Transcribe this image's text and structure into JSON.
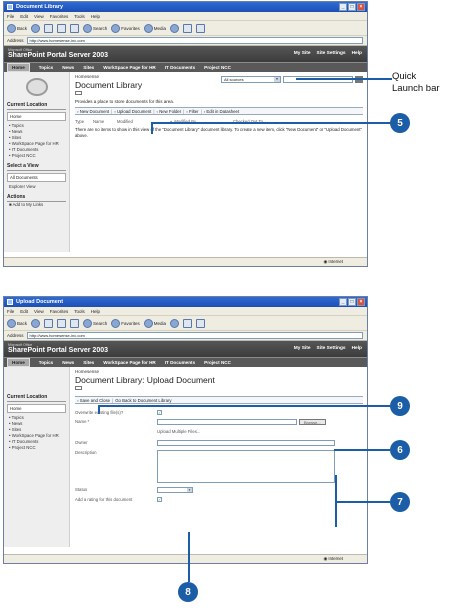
{
  "window1": {
    "title": "Document Library",
    "menu": [
      "File",
      "Edit",
      "View",
      "Favorites",
      "Tools",
      "Help"
    ],
    "toolbar": {
      "back": "Back",
      "search": "Search",
      "favorites": "Favorites",
      "media": "Media"
    },
    "address_label": "Address",
    "address": "http://www.homesense-inc.com",
    "brand_small": "Microsoft Office",
    "brand": "SharePoint Portal Server 2003",
    "toplinks": [
      "My Site",
      "Site Settings",
      "Help"
    ],
    "nav": [
      "Home",
      "Topics",
      "News",
      "Sites",
      "WorkSpace Page for HR",
      "IT Documents",
      "Project NCC"
    ],
    "sidebar": {
      "current_location": "Current Location",
      "home": "Home",
      "items": [
        "Topics",
        "News",
        "Sites",
        "WorkSpace Page for HR",
        "IT Documents",
        "Project NCC"
      ],
      "select_view": "Select a View",
      "views": [
        "All Documents",
        "Explorer View"
      ],
      "actions": "Actions",
      "action_items": [
        "Add to My Links"
      ]
    },
    "breadcrumb": "Homesense",
    "page_title": "Document Library",
    "search_scope": "All sources",
    "description": "Provides a place to store documents for this area.",
    "actions": [
      "New Document",
      "Upload Document",
      "New Folder",
      "Filter",
      "Edit in Datasheet"
    ],
    "columns": [
      "Type",
      "Name",
      "Modified",
      "Modified By",
      "Checked Out To"
    ],
    "empty_message": "There are no items to show in this view of the \"Document Library\" document library. To create a new item, click \"New Document\" or \"Upload Document\" above.",
    "status": "Internet"
  },
  "window2": {
    "title": "Upload Document",
    "menu": [
      "File",
      "Edit",
      "View",
      "Favorites",
      "Tools",
      "Help"
    ],
    "toolbar": {
      "back": "Back",
      "search": "Search",
      "favorites": "Favorites",
      "media": "Media"
    },
    "address_label": "Address",
    "address": "http://www.homesense-inc.com",
    "brand_small": "Microsoft Office",
    "brand": "SharePoint Portal Server 2003",
    "toplinks": [
      "My Site",
      "Site Settings",
      "Help"
    ],
    "nav": [
      "Home",
      "Topics",
      "News",
      "Sites",
      "WorkSpace Page for HR",
      "IT Documents",
      "Project NCC"
    ],
    "sidebar": {
      "current_location": "Current Location",
      "home": "Home",
      "items": [
        "Topics",
        "News",
        "Sites",
        "WorkSpace Page for HR",
        "IT Documents",
        "Project NCC"
      ]
    },
    "breadcrumb": "Homesense",
    "page_title": "Document Library: Upload Document",
    "actions": [
      "Save and Close",
      "Go Back to Document Library"
    ],
    "form": {
      "overwrite_label": "Overwrite existing file(s)?",
      "overwrite_checked": "✓",
      "name_label": "Name *",
      "browse": "Browse...",
      "upload_multiple": "Upload Multiple Files...",
      "owner_label": "Owner",
      "description_label": "Description",
      "status_label": "Status",
      "rating_label": "Add a rating for this document",
      "rating_checked": "✓"
    },
    "status": "Internet"
  },
  "callouts": {
    "quick_launch_label_1": "Quick",
    "quick_launch_label_2": "Launch bar",
    "c5": "5",
    "c9": "9",
    "c6": "6",
    "c7": "7",
    "c8": "8"
  },
  "colors": {
    "callout": "#1b5da6",
    "titlebar": "#1d4fb3",
    "header": "#3c3c3c"
  }
}
